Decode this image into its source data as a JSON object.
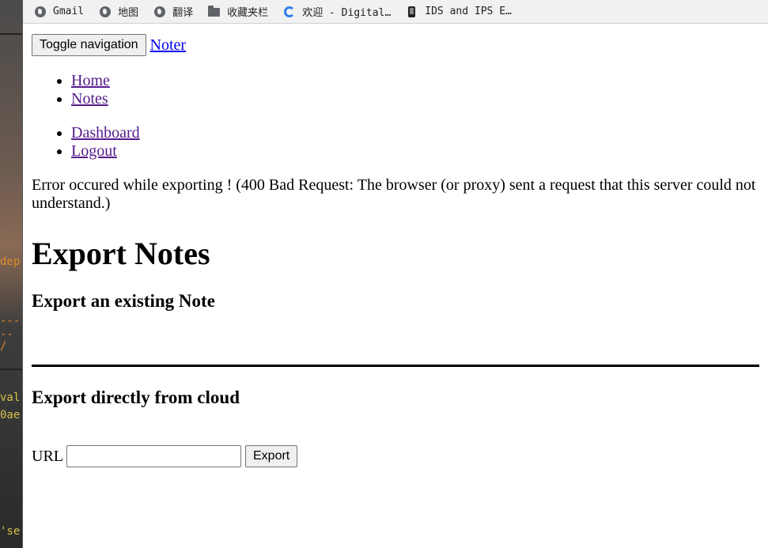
{
  "bookmarks": [
    {
      "label": "Gmail",
      "icon": "globe-icon"
    },
    {
      "label": "地图",
      "icon": "globe-icon"
    },
    {
      "label": "翻译",
      "icon": "globe-icon"
    },
    {
      "label": "收藏夹栏",
      "icon": "folder-icon"
    },
    {
      "label": "欢迎 - Digital…",
      "icon": "spinner-icon"
    },
    {
      "label": "IDS and IPS E…",
      "icon": "phone-icon"
    }
  ],
  "navbar": {
    "toggle_label": "Toggle navigation",
    "brand": "Noter"
  },
  "nav_left": [
    {
      "label": "Home"
    },
    {
      "label": "Notes"
    }
  ],
  "nav_right": [
    {
      "label": "Dashboard"
    },
    {
      "label": "Logout"
    }
  ],
  "error_message": "Error occured while exporting ! (400 Bad Request: The browser (or proxy) sent a request that this server could not understand.)",
  "page": {
    "title": "Export Notes",
    "section1_title": "Export an existing Note",
    "section2_title": "Export directly from cloud"
  },
  "form": {
    "url_label": "URL",
    "url_value": "",
    "export_label": "Export"
  },
  "background_terminal": {
    "fragments": [
      "dep",
      "---",
      " --",
      "/",
      "val",
      "0ae",
      "'se"
    ]
  },
  "colors": {
    "link_visited": "#551a8b",
    "terminal_orange": "#e08a2a",
    "terminal_yellow": "#d8c04a"
  }
}
